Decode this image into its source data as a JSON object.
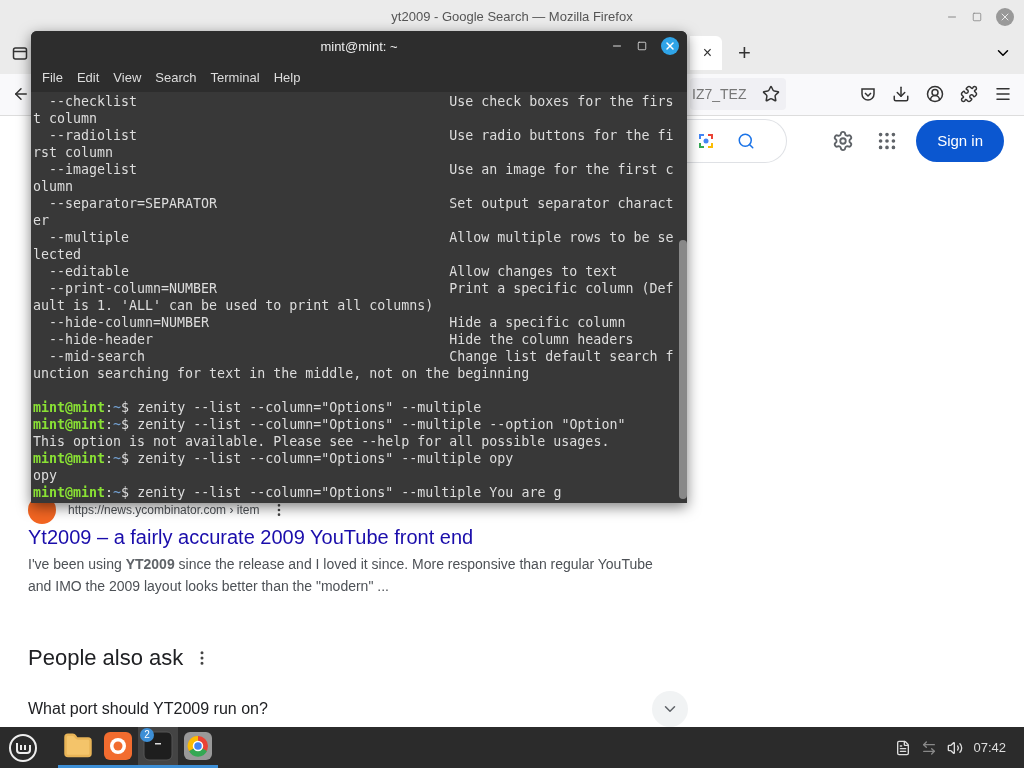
{
  "browser": {
    "window_title": "yt2009 - Google Search — Mozilla Firefox",
    "tabs": [
      {
        "close": "×",
        "selected": true
      }
    ],
    "new_tab": "+",
    "url_fragment": "IZ7_TEZ",
    "sign_in": "Sign in",
    "result": {
      "url": "https://news.ycombinator.com › item",
      "title": "Yt2009 – a fairly accurate 2009 YouTube front end",
      "snippet": "I've been using **YT2009** since the release and I loved it since. More responsive than regular YouTube and IMO the 2009 layout looks better than the \"modern\" ..."
    },
    "people_also_ask": {
      "heading": "People also ask",
      "questions": [
        {
          "text": "What port should YT2009 run on?",
          "expanded": false
        }
      ]
    }
  },
  "terminal": {
    "title": "mint@mint: ~",
    "menu": [
      "File",
      "Edit",
      "View",
      "Search",
      "Terminal",
      "Help"
    ],
    "lines": [
      {
        "kind": "option",
        "option": "  --checklist",
        "description": "Use check boxes for the firs"
      },
      {
        "kind": "output",
        "text": "t column"
      },
      {
        "kind": "option",
        "option": "  --radiolist",
        "description": "Use radio buttons for the fi"
      },
      {
        "kind": "output",
        "text": "rst column"
      },
      {
        "kind": "option",
        "option": "  --imagelist",
        "description": "Use an image for the first c"
      },
      {
        "kind": "output",
        "text": "olumn"
      },
      {
        "kind": "option",
        "option": "  --separator=SEPARATOR",
        "description": "Set output separator charact"
      },
      {
        "kind": "output",
        "text": "er"
      },
      {
        "kind": "option",
        "option": "  --multiple",
        "description": "Allow multiple rows to be se"
      },
      {
        "kind": "output",
        "text": "lected"
      },
      {
        "kind": "option",
        "option": "  --editable",
        "description": "Allow changes to text"
      },
      {
        "kind": "option",
        "option": "  --print-column=NUMBER",
        "description": "Print a specific column (Def"
      },
      {
        "kind": "output",
        "text": "ault is 1. 'ALL' can be used to print all columns)"
      },
      {
        "kind": "option",
        "option": "  --hide-column=NUMBER",
        "description": "Hide a specific column"
      },
      {
        "kind": "option",
        "option": "  --hide-header",
        "description": "Hide the column headers"
      },
      {
        "kind": "option",
        "option": "  --mid-search",
        "description": "Change list default search f"
      },
      {
        "kind": "output",
        "text": "unction searching for text in the middle, not on the beginning"
      },
      {
        "kind": "blank"
      },
      {
        "kind": "prompt",
        "user": "mint@mint",
        "sep": ":",
        "path": "~",
        "symbol": "$",
        "command": "zenity --list --column=\"Options\" --multiple"
      },
      {
        "kind": "prompt",
        "user": "mint@mint",
        "sep": ":",
        "path": "~",
        "symbol": "$",
        "command": "zenity --list --column=\"Options\" --multiple --option \"Option\""
      },
      {
        "kind": "output",
        "text": "This option is not available. Please see --help for all possible usages."
      },
      {
        "kind": "prompt",
        "user": "mint@mint",
        "sep": ":",
        "path": "~",
        "symbol": "$",
        "command": "zenity --list --column=\"Options\" --multiple opy"
      },
      {
        "kind": "output",
        "text": "opy"
      },
      {
        "kind": "prompt",
        "user": "mint@mint",
        "sep": ":",
        "path": "~",
        "symbol": "$",
        "command": "zenity --list --column=\"Options\" --multiple You are g"
      }
    ]
  },
  "taskbar": {
    "apps": [
      {
        "kind": "files",
        "active": false
      },
      {
        "kind": "firefox",
        "active": false
      },
      {
        "kind": "terminal",
        "active": true,
        "badge": "2"
      },
      {
        "kind": "chrome",
        "active": false
      }
    ],
    "clock": "07:42"
  }
}
